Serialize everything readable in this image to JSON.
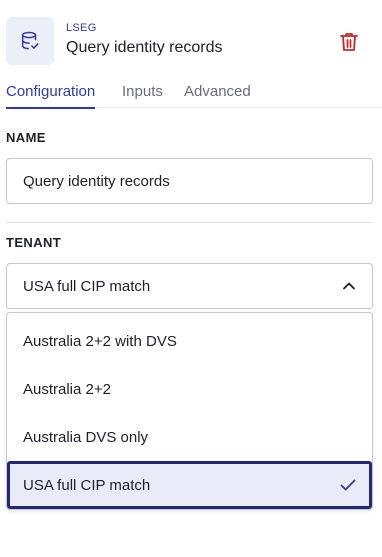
{
  "header": {
    "provider": "LSEG",
    "title": "Query identity records",
    "icon": "database-check-icon",
    "delete_icon": "trash-icon"
  },
  "tabs": [
    {
      "label": "Configuration",
      "active": true
    },
    {
      "label": "Inputs",
      "active": false
    },
    {
      "label": "Advanced",
      "active": false
    }
  ],
  "name_section": {
    "label": "NAME",
    "value": "Query identity records"
  },
  "tenant_section": {
    "label": "TENANT",
    "selected": "USA full CIP match",
    "options": [
      "Australia 2+2 with DVS",
      "Australia 2+2",
      "Australia DVS only",
      "USA full CIP match"
    ]
  },
  "colors": {
    "accent": "#2f3aa8",
    "delete": "#c42a2a",
    "selected_bg": "#e9ebf8",
    "selected_border": "#23287a"
  }
}
